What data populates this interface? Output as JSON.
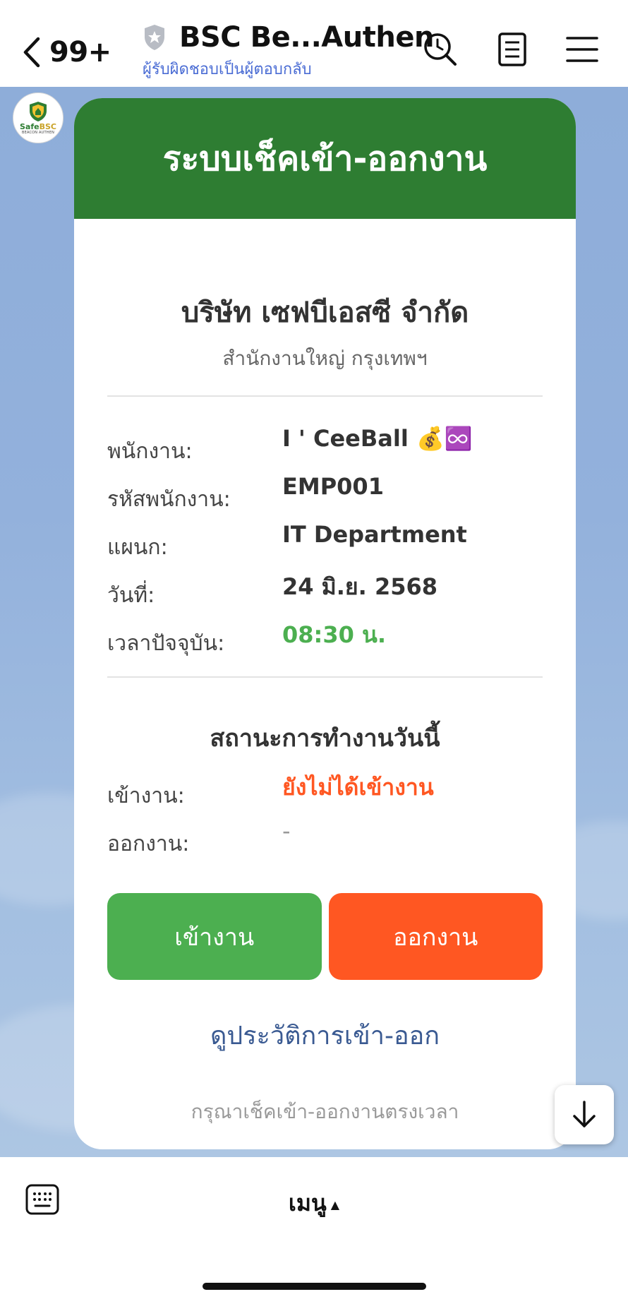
{
  "header": {
    "back_count": "99+",
    "title": "BSC Be...Authen",
    "subtitle": "ผู้รับผิดชอบเป็นผู้ตอบกลับ"
  },
  "avatar": {
    "brand_prefix": "Safe",
    "brand_suffix": "BSC",
    "tagline": "BEACON AUTHEN"
  },
  "card": {
    "header_title": "ระบบเช็คเข้า-ออกงาน",
    "company": "บริษัท เซฟบีเอสซี จำกัด",
    "branch": "สำนักงานใหญ่ กรุงเทพฯ",
    "info": [
      {
        "label": "พนักงาน:",
        "value": "I ' CeeBall 💰♾️"
      },
      {
        "label": "รหัสพนักงาน:",
        "value": "EMP001"
      },
      {
        "label": "แผนก:",
        "value": "IT Department"
      },
      {
        "label": "วันที่:",
        "value": "24 มิ.ย. 2568"
      },
      {
        "label": "เวลาปัจจุบัน:",
        "value": "08:30 น."
      }
    ],
    "status_title": "สถานะการทำงานวันนี้",
    "status": [
      {
        "label": "เข้างาน:",
        "value": "ยังไม่ได้เข้างาน"
      },
      {
        "label": "ออกงาน:",
        "value": "-"
      }
    ],
    "check_in_label": "เข้างาน",
    "check_out_label": "ออกงาน",
    "history_link": "ดูประวัติการเข้า-ออก",
    "footer_note": "กรุณาเช็คเข้า-ออกงานตรงเวลา"
  },
  "bottom": {
    "menu_label": "เมนู"
  },
  "colors": {
    "header_green": "#2e7d32",
    "check_in_green": "#4caf50",
    "check_out_orange": "#ff5722",
    "link_blue": "#3a5a92",
    "chat_background": "#8eadd9"
  }
}
